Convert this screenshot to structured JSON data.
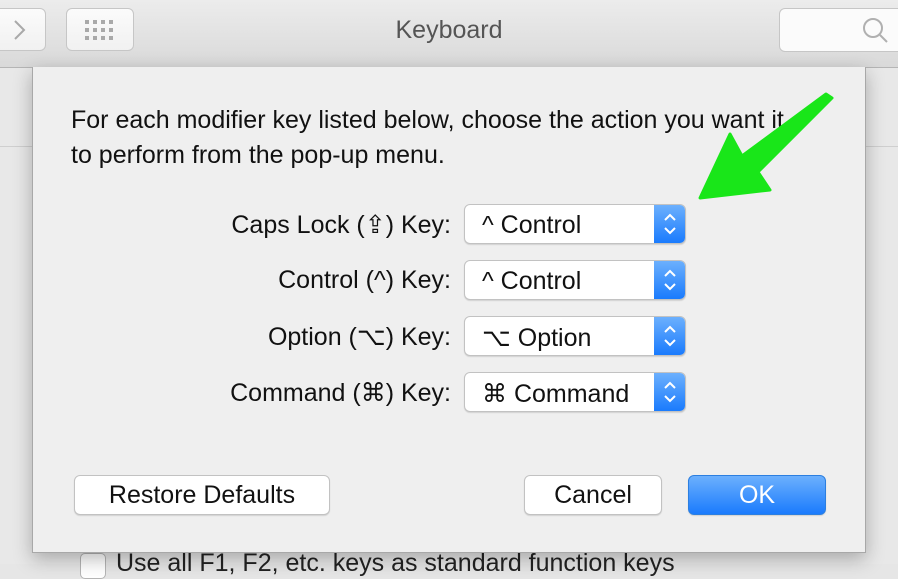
{
  "window": {
    "title": "Keyboard",
    "search_placeholder": ""
  },
  "toolbar": {
    "forward_icon": "chevron-right-icon",
    "grid_icon": "show-all-grid-icon",
    "search_icon": "magnifier-icon"
  },
  "sheet": {
    "intro": "For each modifier key listed below, choose the action you want it to perform from the pop-up menu.",
    "rows": [
      {
        "label": "Caps Lock (⇪) Key:",
        "value": "^ Control"
      },
      {
        "label": "Control (^) Key:",
        "value": "^ Control"
      },
      {
        "label": "Option (⌥) Key:",
        "value": "⌥ Option"
      },
      {
        "label": "Command (⌘) Key:",
        "value": "⌘ Command"
      }
    ],
    "buttons": {
      "restore": "Restore Defaults",
      "cancel": "Cancel",
      "ok": "OK"
    }
  },
  "background": {
    "checkbox_label": "Use all F1, F2, etc. keys as standard function keys"
  },
  "annotation": {
    "arrow_color": "#19e619"
  },
  "colors": {
    "accent": "#1a7bfd"
  }
}
